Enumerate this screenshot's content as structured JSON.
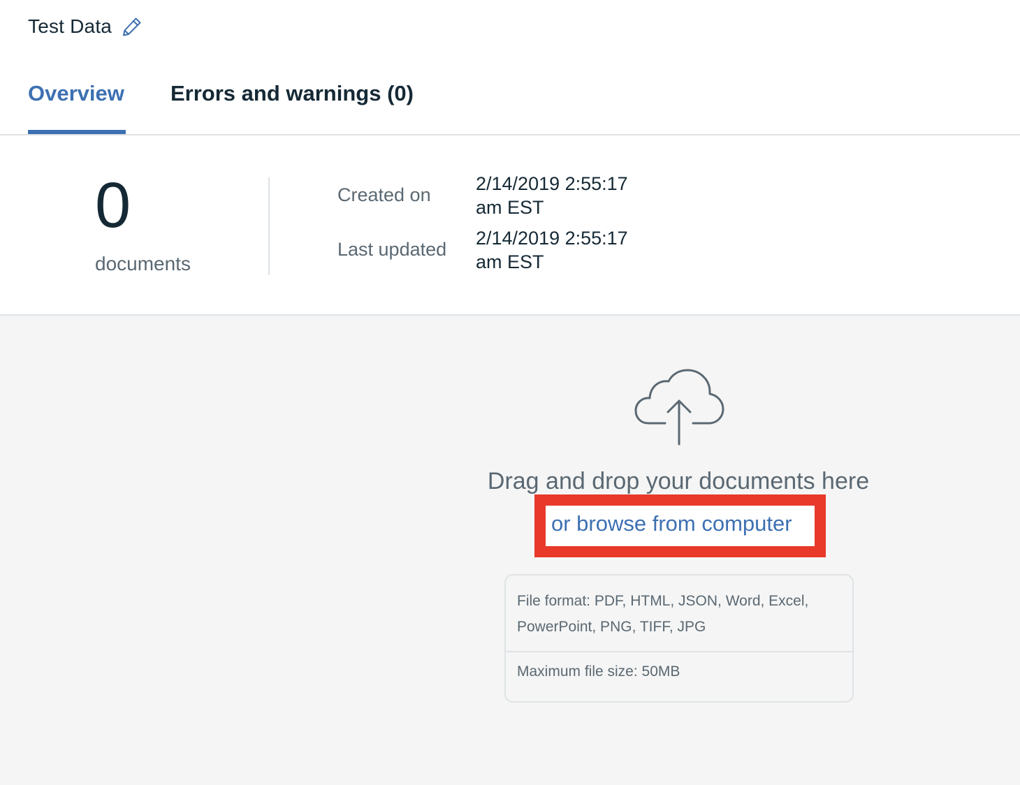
{
  "header": {
    "title": "Test Data",
    "edit_icon": "pencil-icon"
  },
  "tabs": [
    {
      "label": "Overview",
      "active": true
    },
    {
      "label": "Errors and warnings (0)",
      "active": false
    }
  ],
  "stats": {
    "document_count": "0",
    "document_label": "documents",
    "created_label": "Created on",
    "created_value": "2/14/2019 2:55:17 am EST",
    "updated_label": "Last updated",
    "updated_value": "2/14/2019 2:55:17 am EST"
  },
  "upload": {
    "icon": "cloud-upload-icon",
    "drag_text": "Drag and drop your documents here",
    "browse_link": "or browse from computer",
    "file_formats": "File format: PDF, HTML, JSON, Word, Excel, PowerPoint, PNG, TIFF, JPG",
    "max_size": "Maximum file size: 50MB"
  },
  "colors": {
    "accent": "#3d70b2",
    "highlight": "#e8392a",
    "text_primary": "#152935",
    "text_secondary": "#5a6872",
    "upload_bg": "#f5f5f5"
  }
}
